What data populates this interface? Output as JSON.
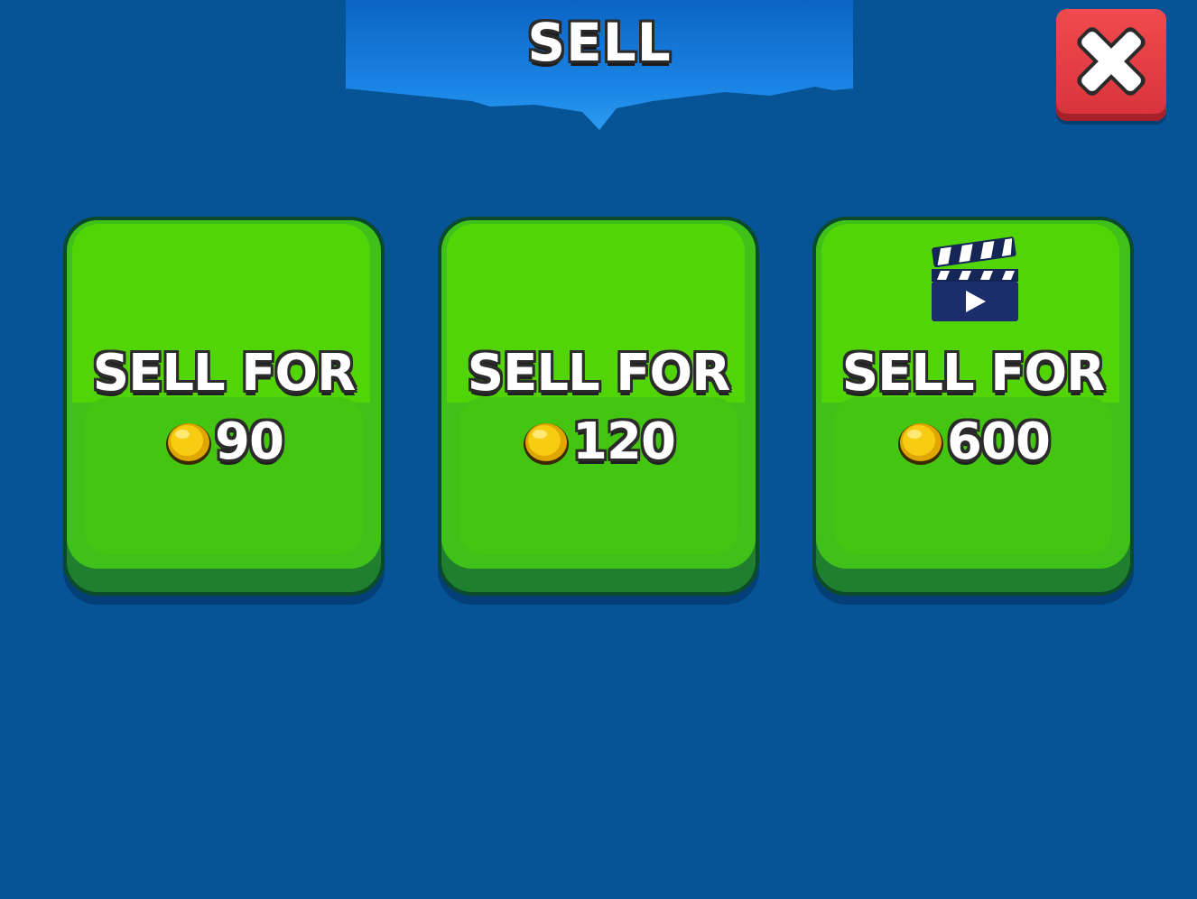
{
  "header": {
    "title": "SELL"
  },
  "close_button": {
    "icon": "close-icon"
  },
  "options": [
    {
      "label": "SELL FOR",
      "price": "90",
      "currency_icon": "coin-icon",
      "requires_video": false
    },
    {
      "label": "SELL FOR",
      "price": "120",
      "currency_icon": "coin-icon",
      "requires_video": false
    },
    {
      "label": "SELL FOR",
      "price": "600",
      "currency_icon": "coin-icon",
      "requires_video": true,
      "badge_icon": "video-clapperboard-icon"
    }
  ],
  "colors": {
    "background": "#065396",
    "banner": "#1a7fe0",
    "card_green": "#52d506",
    "card_border": "#0b4a2b",
    "close_red": "#e63c43",
    "coin_gold": "#f5c400"
  }
}
